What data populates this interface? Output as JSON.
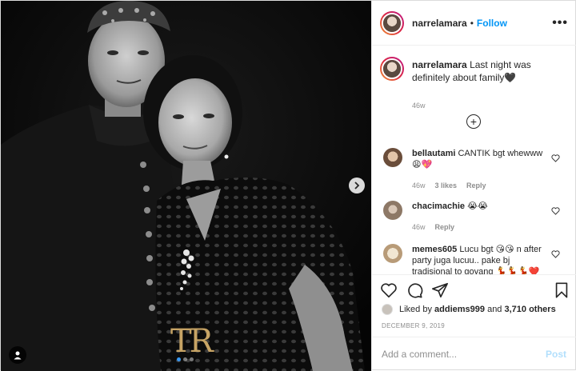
{
  "post": {
    "username": "narrelamara",
    "separator": "•",
    "follow_label": "Follow",
    "more_label": "•••",
    "watermark": "TR",
    "carousel": {
      "total": 3,
      "active": 0
    }
  },
  "caption": {
    "username": "narrelamara",
    "text": "Last night was definitely about family🖤",
    "time": "46w"
  },
  "comments": [
    {
      "username": "bellautami",
      "text": "CANTIK bgt whewww 😩💖",
      "time": "46w",
      "likes": "3 likes",
      "reply_label": "Reply"
    },
    {
      "username": "chacimachie",
      "text": "😭😭",
      "time": "46w",
      "likes": "",
      "reply_label": "Reply"
    },
    {
      "username": "memes605",
      "text": "Lucu bgt 😘😘 n after party juga lucuu.. pake bj tradisional to goyang 💃💃💃❤️",
      "time": "",
      "likes": "",
      "reply_label": ""
    }
  ],
  "likes": {
    "prefix": "Liked by ",
    "first_user": "addiems999",
    "connector": " and ",
    "others": "3,710 others"
  },
  "date": "DECEMBER 9, 2019",
  "add_comment": {
    "placeholder": "Add a comment...",
    "post_label": "Post"
  },
  "colors": {
    "link_blue": "#0095f6",
    "post_disabled": "#b2dffc",
    "muted": "#8e8e8e",
    "watermark_gold": "#c7a465",
    "carousel_active": "#3897f0"
  }
}
